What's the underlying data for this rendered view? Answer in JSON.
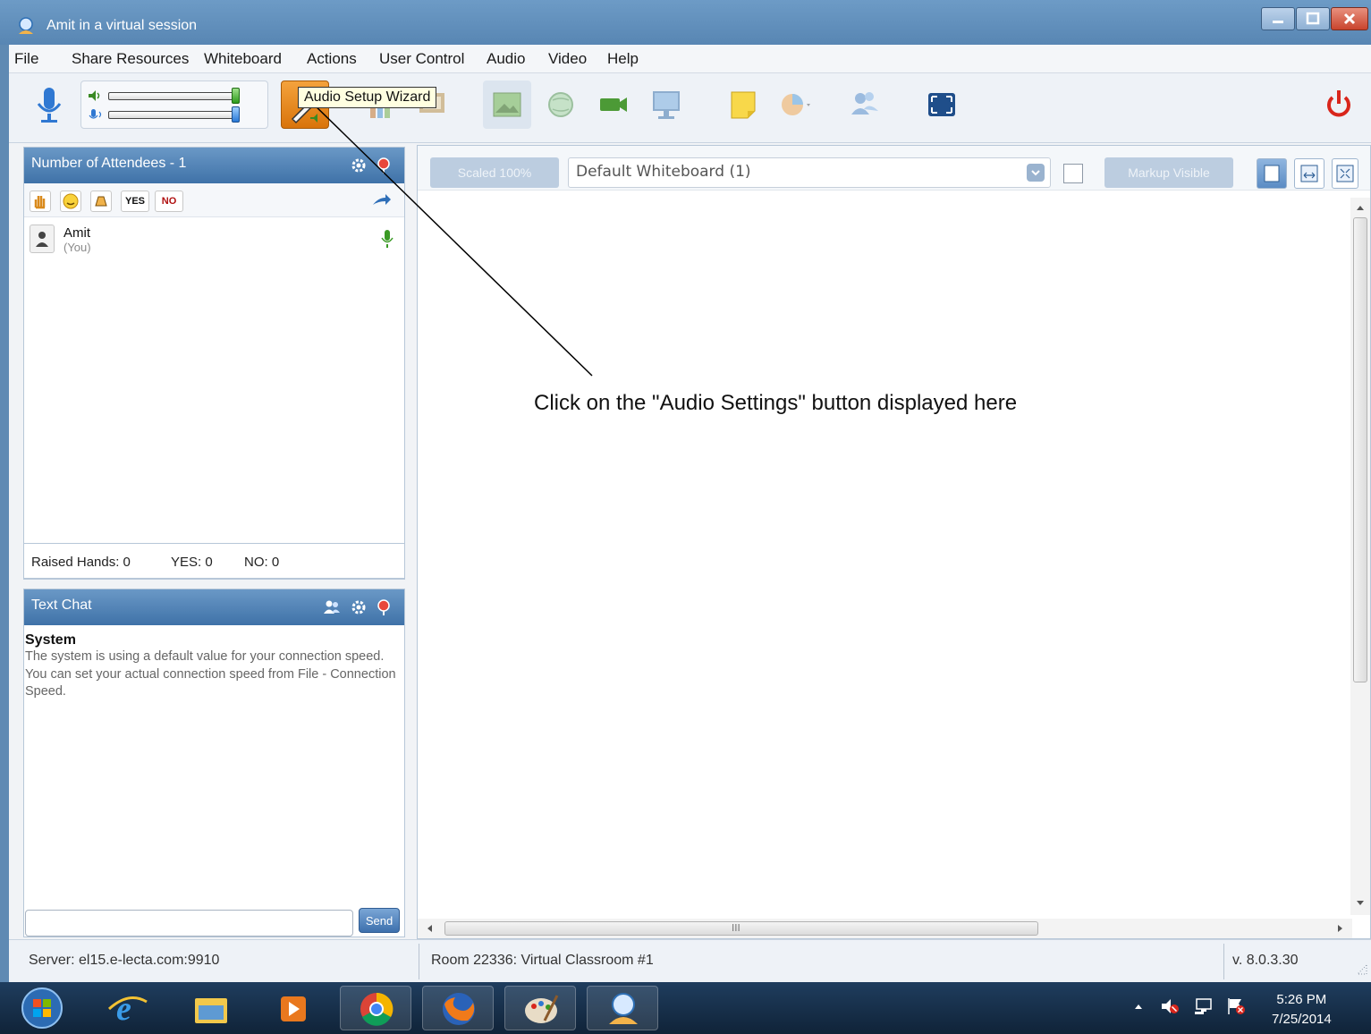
{
  "window": {
    "title": "Amit in a virtual session"
  },
  "menu": {
    "items": [
      "File",
      "Share Resources",
      "Whiteboard",
      "Actions",
      "User Control",
      "Audio",
      "Video",
      "Help"
    ]
  },
  "toolbar": {
    "tooltip": "Audio Setup Wizard",
    "speaker_volume": 1.0,
    "mic_volume": 1.0
  },
  "attendees": {
    "header": "Number of Attendees - 1",
    "reactions": {
      "yes": "YES",
      "no": "NO"
    },
    "list": [
      {
        "name": "Amit",
        "sub": "(You)"
      }
    ],
    "counts": {
      "raised": "Raised Hands: 0",
      "yes": "YES: 0",
      "no": "NO: 0"
    }
  },
  "chat": {
    "header": "Text Chat",
    "messages": [
      {
        "from": "System",
        "text": "The system is using a default value for your connection speed. You can set your actual connection speed from File - Connection Speed."
      }
    ],
    "send_label": "Send",
    "input_value": ""
  },
  "whiteboard": {
    "scaled_label": "Scaled 100%",
    "selected": "Default Whiteboard (1)",
    "markup_label": "Markup Visible",
    "hscroll_mark": "III"
  },
  "annotation": {
    "text": "Click on the \"Audio Settings\" button displayed here"
  },
  "status": {
    "server": "Server: el15.e-lecta.com:9910",
    "room": "Room 22336: Virtual Classroom #1",
    "version": "v. 8.0.3.30"
  },
  "taskbar": {
    "time": "5:26 PM",
    "date": "7/25/2014"
  },
  "colors": {
    "title_bar": "#5f8ab3",
    "panel_header": "#4f80b3",
    "audio_wizard_button": "#e8820f",
    "annotation_line": "#000000"
  }
}
